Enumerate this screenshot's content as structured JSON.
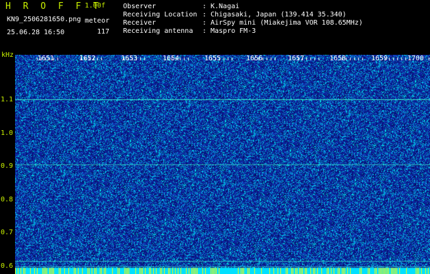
{
  "header": {
    "app_title": "H R O F F T",
    "version": "1.00f",
    "filename": "KN9_2506281650.png",
    "timestamp": "25.06.28 16:50",
    "meteor_label": "meteor",
    "meteor_count": "117"
  },
  "info": [
    {
      "key": "Observer",
      "value": "K.Nagai"
    },
    {
      "key": "Receiving Location",
      "value": "Chigasaki, Japan (139.414 35.340)"
    },
    {
      "key": "Receiver",
      "value": "AirSpy mini (Miakejima VOR 108.65MHz)"
    },
    {
      "key": "Receiving antenna",
      "value": "Maspro FM-3"
    }
  ],
  "colors": {
    "label_yellow": "#c8f000",
    "background_blue": "#0a1a8c",
    "noise_cyan": "#00e0ff",
    "carrier_line": "#40ffd0",
    "bottom_band": "#00e0ff"
  },
  "chart_data": {
    "type": "heatmap",
    "ylabel": "kHz",
    "y_ticks": [
      "1.1",
      "1.0",
      "0.9",
      "0.8",
      "0.7",
      "0.6"
    ],
    "x_ticks": [
      "1651",
      "1652",
      "1653",
      "1654",
      "1655",
      "1656",
      "1657",
      "1658",
      "1659",
      "1700"
    ],
    "ylim": [
      0.575,
      1.235
    ],
    "carrier_lines_khz": [
      1.1,
      0.906,
      0.615,
      0.598
    ]
  }
}
